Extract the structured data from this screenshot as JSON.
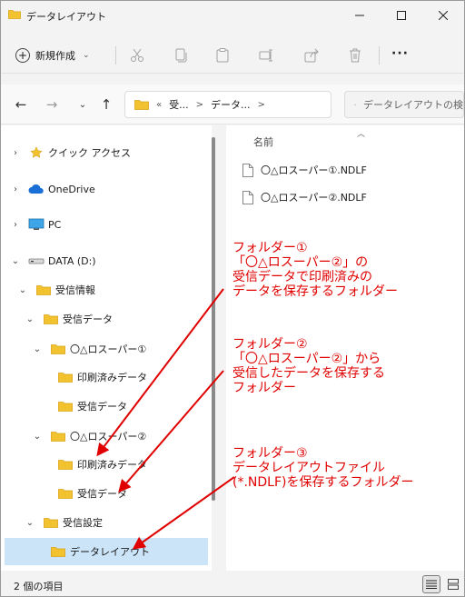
{
  "window": {
    "title": "データレイアウト"
  },
  "commandbar": {
    "new_label": "新規作成"
  },
  "address": {
    "crumbs": [
      "«",
      "受...",
      ">",
      "データ...",
      ">"
    ]
  },
  "search": {
    "placeholder": "データレイアウトの検索"
  },
  "nav": {
    "items": [
      {
        "label": "クイック アクセス"
      },
      {
        "label": "OneDrive"
      },
      {
        "label": "PC"
      },
      {
        "label": "DATA (D:)"
      },
      {
        "label": "受信情報"
      },
      {
        "label": "受信データ"
      },
      {
        "label": "〇△ロスーパー①"
      },
      {
        "label": "印刷済みデータ"
      },
      {
        "label": "受信データ"
      },
      {
        "label": "〇△ロスーパー②"
      },
      {
        "label": "印刷済みデータ"
      },
      {
        "label": "受信データ"
      },
      {
        "label": "受信設定"
      },
      {
        "label": "データレイアウト"
      }
    ]
  },
  "content": {
    "column_name": "名前",
    "files": [
      {
        "name": "〇△ロスーパー①.NDLF"
      },
      {
        "name": "〇△ロスーパー②.NDLF"
      }
    ]
  },
  "status": {
    "text": "2 個の項目"
  },
  "annotations": {
    "a1": [
      "フォルダー①",
      "「〇△ロスーパー②」の",
      "受信データで印刷済みの",
      "データを保存するフォルダー"
    ],
    "a2": [
      "フォルダー②",
      "「〇△ロスーパー②」から",
      "受信したデータを保存する",
      "フォルダー"
    ],
    "a3": [
      "フォルダー③",
      "データレイアウトファイル",
      "(*.NDLF)を保存するフォルダー"
    ]
  },
  "colors": {
    "folder": "#f2c230",
    "annotation": "#e00000",
    "selection": "#cce4f7",
    "accent": "#1a6fd6"
  }
}
